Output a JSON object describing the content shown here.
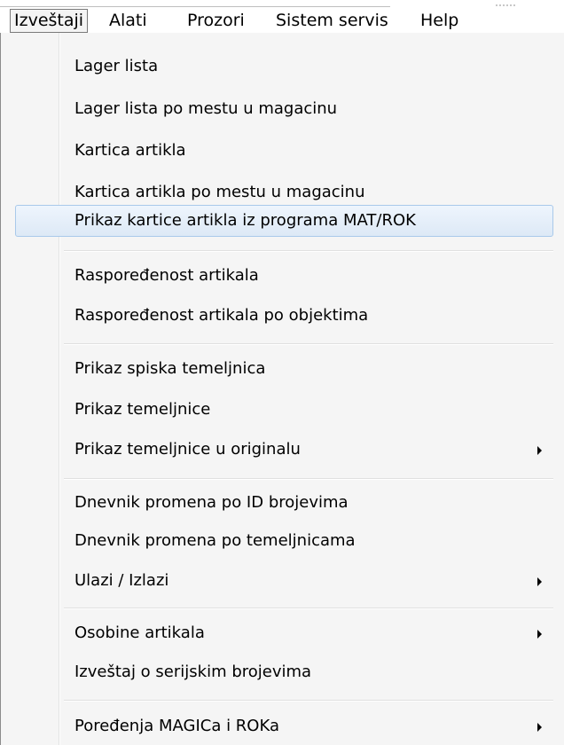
{
  "menubar": {
    "items": [
      "Izveštaji",
      "Alati",
      "Prozori",
      "Sistem servis",
      "Help"
    ]
  },
  "dropdown": {
    "items": [
      {
        "label": "Lager lista"
      },
      {
        "label": "Lager lista po mestu u magacinu"
      },
      {
        "label": "Kartica artikla"
      },
      {
        "label": "Kartica artikla po mestu u magacinu"
      },
      {
        "label": "Prikaz kartice artikla iz programa MAT/ROK",
        "highlighted": true
      },
      {
        "label": "Raspoređenost artikala"
      },
      {
        "label": "Raspoređenost artikala po objektima"
      },
      {
        "label": "Prikaz spiska temeljnica"
      },
      {
        "label": "Prikaz temeljnice"
      },
      {
        "label": "Prikaz temeljnice u originalu",
        "submenu": true
      },
      {
        "label": "Dnevnik promena po ID brojevima"
      },
      {
        "label": "Dnevnik promena po temeljnicama"
      },
      {
        "label": "Ulazi / Izlazi",
        "submenu": true
      },
      {
        "label": "Osobine artikala",
        "submenu": true
      },
      {
        "label": "Izveštaj o serijskim brojevima"
      },
      {
        "label": "Poređenja MAGICa i ROKa",
        "submenu": true
      }
    ]
  },
  "colors": {
    "highlight_fill": "#dde9f6",
    "highlight_border": "#a9c9ea",
    "menu_background": "#f5f5f5"
  }
}
